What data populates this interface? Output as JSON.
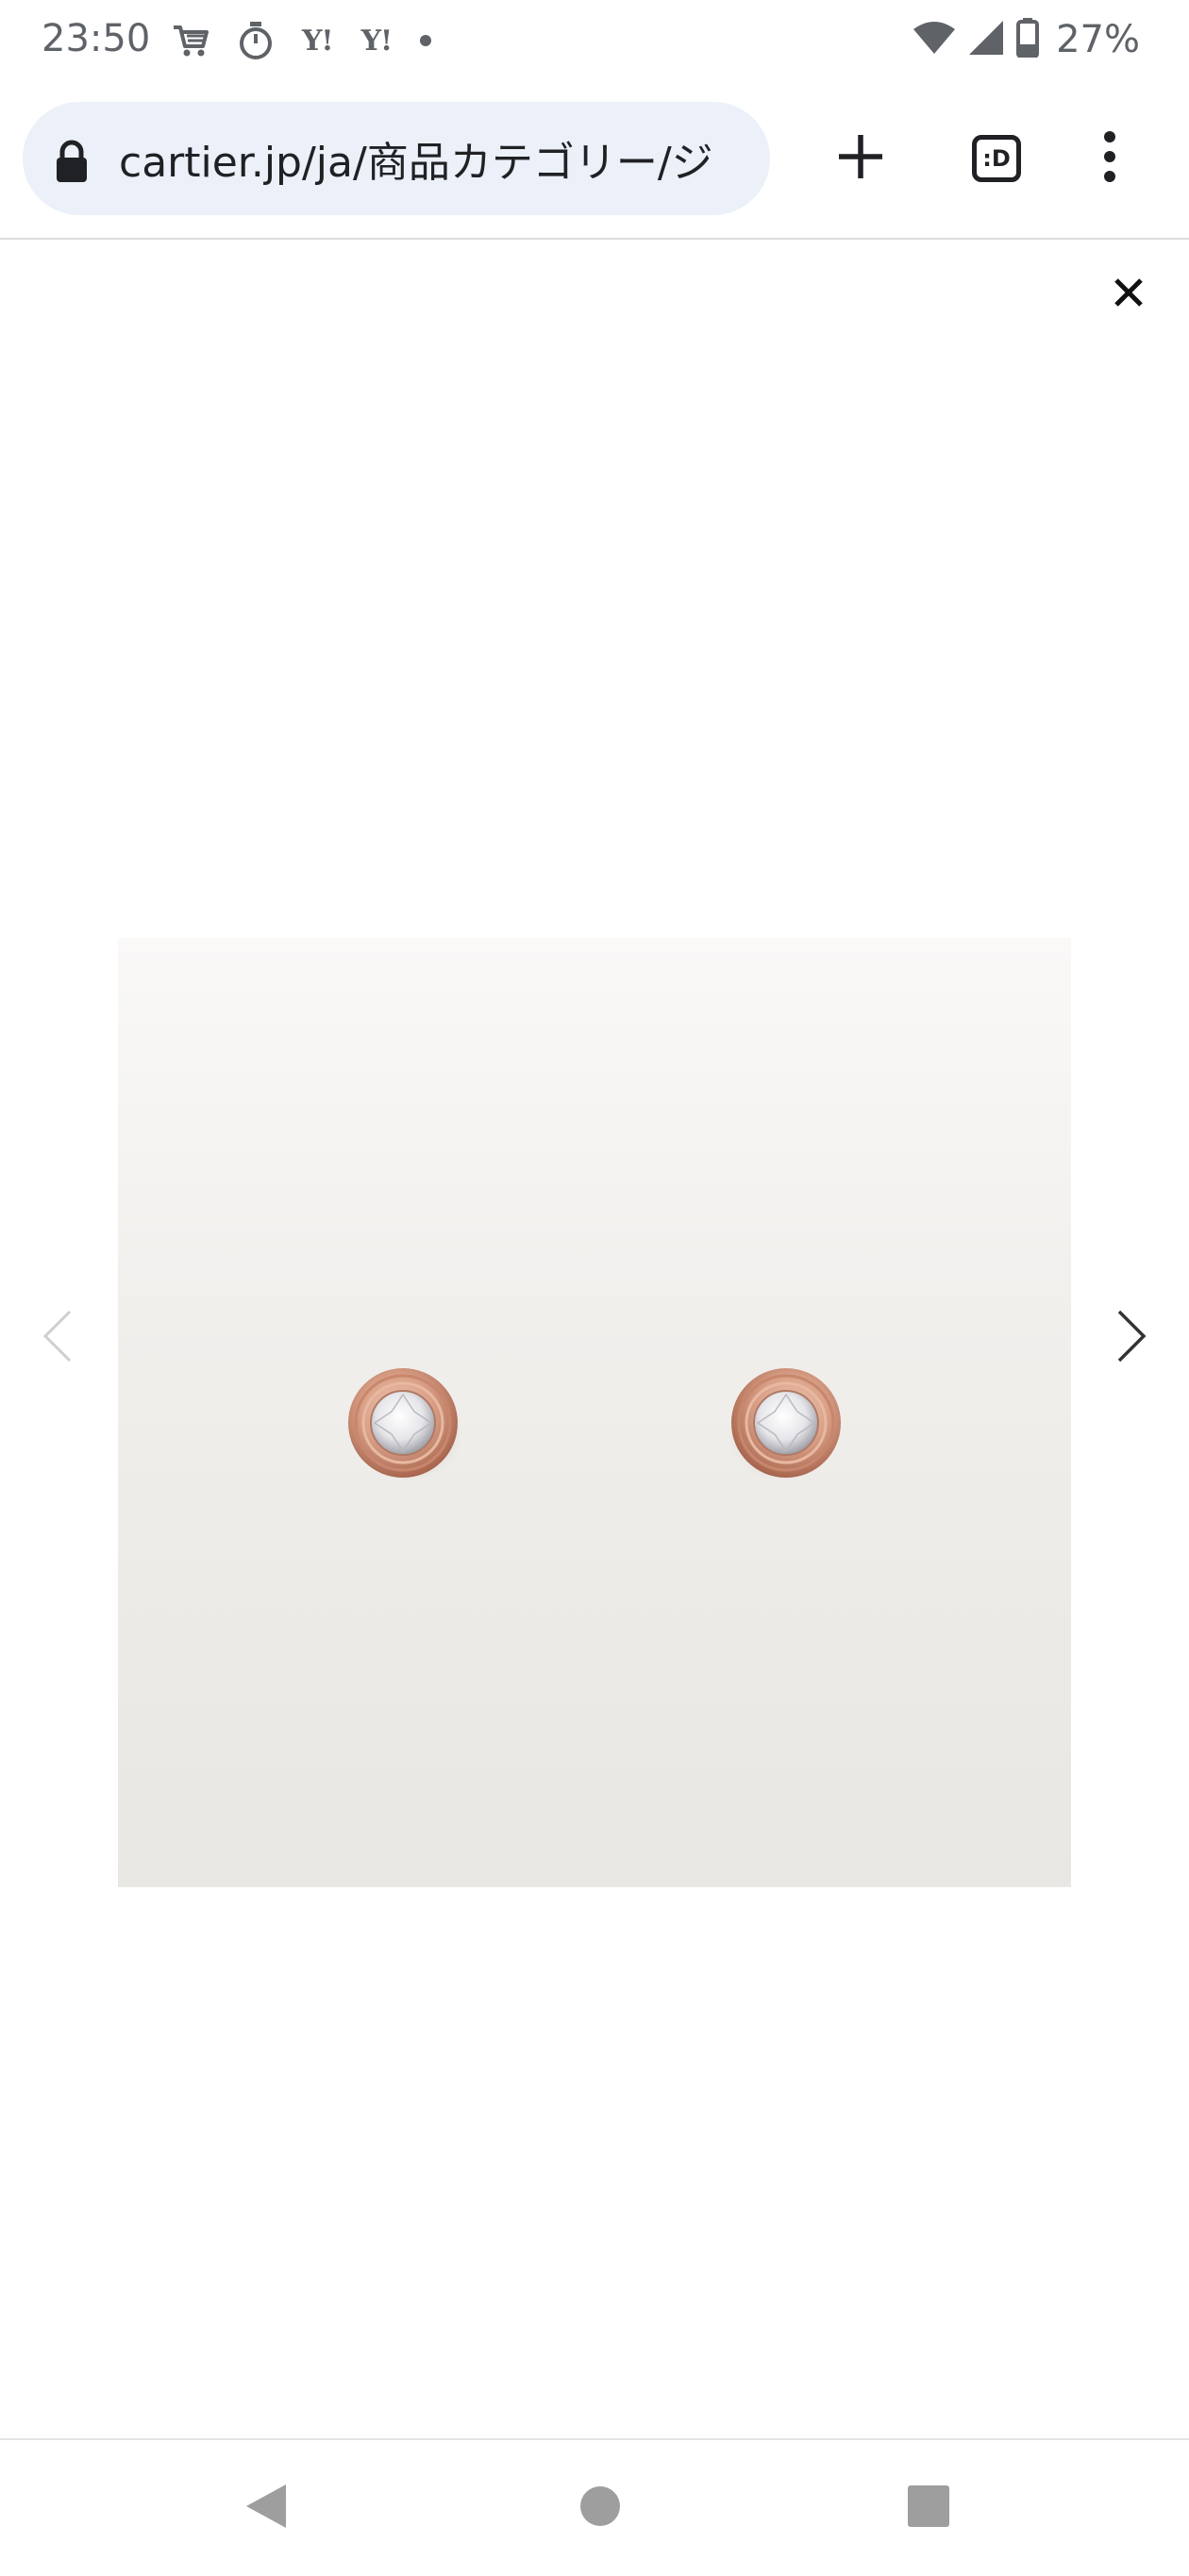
{
  "status_bar": {
    "time": "23:50",
    "left_icons": [
      "shopping-cart-icon",
      "stopwatch-icon",
      "yahoo-icon",
      "yahoo-icon",
      "dot-icon"
    ],
    "yahoo_1": "Y!",
    "yahoo_2": "Y!",
    "battery_percent": "27%"
  },
  "browser": {
    "url": "cartier.jp/ja/商品カテゴリー/ジ",
    "tab_switcher_label": ":D",
    "icons": {
      "lock": "lock-icon",
      "new_tab": "plus-icon",
      "tabs": "tab-switcher-icon",
      "menu": "more-vert-icon"
    }
  },
  "gallery": {
    "close_icon": "close-icon",
    "prev_icon": "chevron-left-icon",
    "next_icon": "chevron-right-icon",
    "image_description_icon": "earrings-image",
    "colors": {
      "gold": "#d49a82",
      "background": "#eceae6"
    }
  },
  "navbar": {
    "back": "back-triangle-icon",
    "home": "home-circle-icon",
    "recents": "recents-square-icon"
  }
}
